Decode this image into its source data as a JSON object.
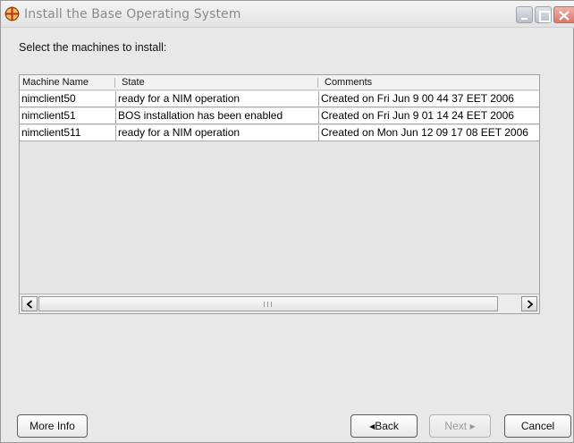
{
  "window": {
    "title": "Install the Base Operating System"
  },
  "main": {
    "prompt": "Select the machines to install:"
  },
  "table": {
    "columns": [
      "Machine Name",
      "State",
      "Comments"
    ],
    "rows": [
      {
        "machine": "nimclient50",
        "state": "ready for a NIM operation",
        "comments": "Created on Fri Jun 9 00 44 37 EET 2006"
      },
      {
        "machine": "nimclient51",
        "state": "BOS installation has been enabled",
        "comments": "Created on Fri Jun 9 01 14 24 EET 2006"
      },
      {
        "machine": "nimclient511",
        "state": "ready for a NIM operation",
        "comments": "Created on Mon Jun 12 09 17 08 EET 2006"
      }
    ],
    "scrollbar": {
      "left_icon": "chevron-left-icon",
      "right_icon": "chevron-right-icon"
    }
  },
  "buttons": {
    "more_info": "More Info",
    "back": "Back",
    "next": "Next",
    "cancel": "Cancel"
  },
  "icons": {
    "app": "crosshair-globe-icon",
    "minimize": "minimize-icon",
    "maximize": "maximize-icon",
    "close": "close-icon"
  },
  "colors": {
    "window_bg": "#e8e8e8",
    "close_button": "#d97868",
    "icon_accent": "#c0262d"
  }
}
